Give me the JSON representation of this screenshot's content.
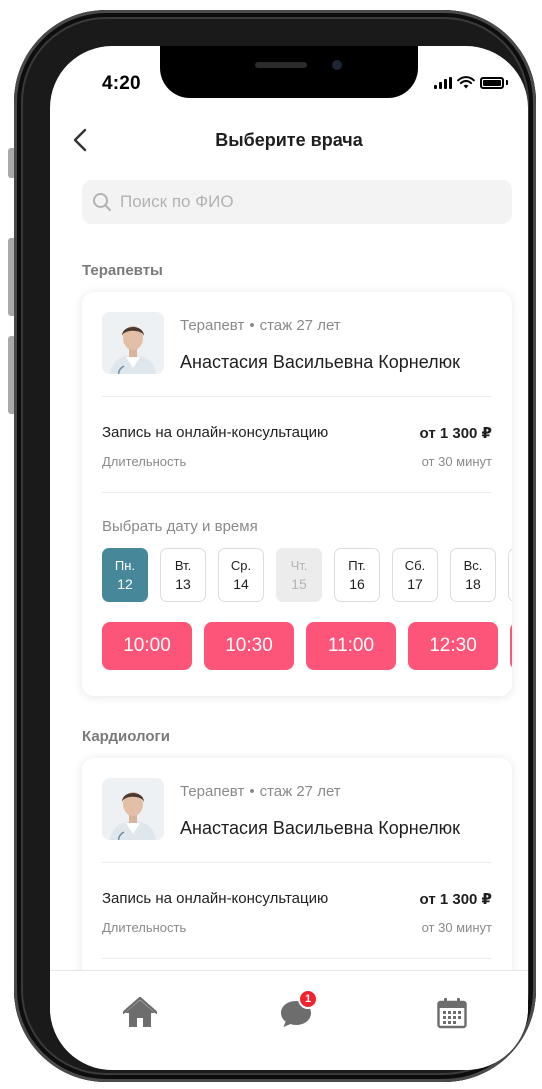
{
  "status_bar": {
    "time": "4:20"
  },
  "header": {
    "title": "Выберите врача",
    "back_icon": "chevron-left-icon"
  },
  "search": {
    "placeholder": "Поиск по ФИО",
    "value": "",
    "icon": "search-icon"
  },
  "colors": {
    "accent_teal": "#46889a",
    "slot_pink": "#fd5479",
    "badge_red": "#f0242f"
  },
  "sections": [
    {
      "title": "Терапевты",
      "card": {
        "specialty": "Терапевт",
        "experience": "стаж 27 лет",
        "name": "Анастасия Васильевна Корнелюк",
        "service": "Запись на онлайн-консультацию",
        "price": "от 1 300 ₽",
        "duration_label": "Длительность",
        "duration_value": "от 30 минут",
        "choose_label": "Выбрать дату и время",
        "days": [
          {
            "weekday": "Пн.",
            "date": "12",
            "state": "selected"
          },
          {
            "weekday": "Вт.",
            "date": "13",
            "state": "available"
          },
          {
            "weekday": "Ср.",
            "date": "14",
            "state": "available"
          },
          {
            "weekday": "Чт.",
            "date": "15",
            "state": "disabled"
          },
          {
            "weekday": "Пт.",
            "date": "16",
            "state": "available"
          },
          {
            "weekday": "Сб.",
            "date": "17",
            "state": "available"
          },
          {
            "weekday": "Вс.",
            "date": "18",
            "state": "available"
          }
        ],
        "slots": [
          "10:00",
          "10:30",
          "11:00",
          "12:30"
        ]
      }
    },
    {
      "title": "Кардиологи",
      "card": {
        "specialty": "Терапевт",
        "experience": "стаж 27 лет",
        "name": "Анастасия Васильевна Корнелюк",
        "service": "Запись на онлайн-консультацию",
        "price": "от 1 300 ₽",
        "duration_label": "Длительность",
        "duration_value": "от 30 минут"
      }
    }
  ],
  "tabbar": {
    "items": [
      {
        "icon": "home-icon"
      },
      {
        "icon": "chat-icon",
        "badge": "1"
      },
      {
        "icon": "calendar-icon"
      }
    ]
  }
}
